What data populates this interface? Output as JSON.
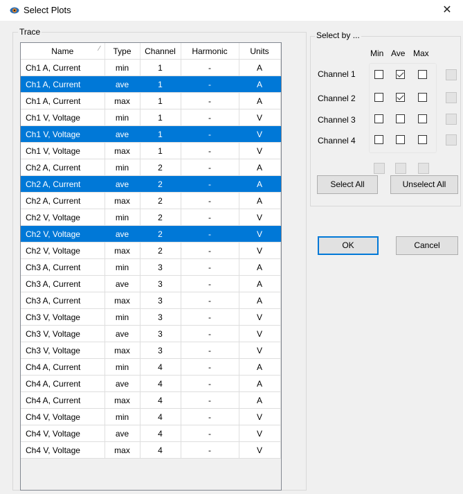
{
  "window": {
    "title": "Select Plots",
    "close": "✕"
  },
  "trace": {
    "legend": "Trace",
    "columns": [
      "Name",
      "Type",
      "Channel",
      "Harmonic",
      "Units"
    ],
    "sort_glyph": "⁄",
    "rows": [
      {
        "name": "Ch1 A, Current",
        "type": "min",
        "channel": "1",
        "harmonic": "-",
        "units": "A",
        "selected": false
      },
      {
        "name": "Ch1 A, Current",
        "type": "ave",
        "channel": "1",
        "harmonic": "-",
        "units": "A",
        "selected": true
      },
      {
        "name": "Ch1 A, Current",
        "type": "max",
        "channel": "1",
        "harmonic": "-",
        "units": "A",
        "selected": false
      },
      {
        "name": "Ch1 V, Voltage",
        "type": "min",
        "channel": "1",
        "harmonic": "-",
        "units": "V",
        "selected": false
      },
      {
        "name": "Ch1 V, Voltage",
        "type": "ave",
        "channel": "1",
        "harmonic": "-",
        "units": "V",
        "selected": true
      },
      {
        "name": "Ch1 V, Voltage",
        "type": "max",
        "channel": "1",
        "harmonic": "-",
        "units": "V",
        "selected": false
      },
      {
        "name": "Ch2 A, Current",
        "type": "min",
        "channel": "2",
        "harmonic": "-",
        "units": "A",
        "selected": false
      },
      {
        "name": "Ch2 A, Current",
        "type": "ave",
        "channel": "2",
        "harmonic": "-",
        "units": "A",
        "selected": true
      },
      {
        "name": "Ch2 A, Current",
        "type": "max",
        "channel": "2",
        "harmonic": "-",
        "units": "A",
        "selected": false
      },
      {
        "name": "Ch2 V, Voltage",
        "type": "min",
        "channel": "2",
        "harmonic": "-",
        "units": "V",
        "selected": false
      },
      {
        "name": "Ch2 V, Voltage",
        "type": "ave",
        "channel": "2",
        "harmonic": "-",
        "units": "V",
        "selected": true
      },
      {
        "name": "Ch2 V, Voltage",
        "type": "max",
        "channel": "2",
        "harmonic": "-",
        "units": "V",
        "selected": false
      },
      {
        "name": "Ch3 A, Current",
        "type": "min",
        "channel": "3",
        "harmonic": "-",
        "units": "A",
        "selected": false
      },
      {
        "name": "Ch3 A, Current",
        "type": "ave",
        "channel": "3",
        "harmonic": "-",
        "units": "A",
        "selected": false
      },
      {
        "name": "Ch3 A, Current",
        "type": "max",
        "channel": "3",
        "harmonic": "-",
        "units": "A",
        "selected": false
      },
      {
        "name": "Ch3 V, Voltage",
        "type": "min",
        "channel": "3",
        "harmonic": "-",
        "units": "V",
        "selected": false
      },
      {
        "name": "Ch3 V, Voltage",
        "type": "ave",
        "channel": "3",
        "harmonic": "-",
        "units": "V",
        "selected": false
      },
      {
        "name": "Ch3 V, Voltage",
        "type": "max",
        "channel": "3",
        "harmonic": "-",
        "units": "V",
        "selected": false
      },
      {
        "name": "Ch4 A, Current",
        "type": "min",
        "channel": "4",
        "harmonic": "-",
        "units": "A",
        "selected": false
      },
      {
        "name": "Ch4 A, Current",
        "type": "ave",
        "channel": "4",
        "harmonic": "-",
        "units": "A",
        "selected": false
      },
      {
        "name": "Ch4 A, Current",
        "type": "max",
        "channel": "4",
        "harmonic": "-",
        "units": "A",
        "selected": false
      },
      {
        "name": "Ch4 V, Voltage",
        "type": "min",
        "channel": "4",
        "harmonic": "-",
        "units": "V",
        "selected": false
      },
      {
        "name": "Ch4 V, Voltage",
        "type": "ave",
        "channel": "4",
        "harmonic": "-",
        "units": "V",
        "selected": false
      },
      {
        "name": "Ch4 V, Voltage",
        "type": "max",
        "channel": "4",
        "harmonic": "-",
        "units": "V",
        "selected": false
      }
    ]
  },
  "select_by": {
    "legend": "Select by ...",
    "column_headers": [
      "Min",
      "Ave",
      "Max"
    ],
    "channels": [
      {
        "label": "Channel 1",
        "min": false,
        "ave": true,
        "max": false
      },
      {
        "label": "Channel 2",
        "min": false,
        "ave": true,
        "max": false
      },
      {
        "label": "Channel 3",
        "min": false,
        "ave": false,
        "max": false
      },
      {
        "label": "Channel 4",
        "min": false,
        "ave": false,
        "max": false
      }
    ],
    "select_all": "Select All",
    "unselect_all": "Unselect All"
  },
  "buttons": {
    "ok": "OK",
    "cancel": "Cancel"
  },
  "colors": {
    "selection": "#0078d7",
    "focus_border": "#0078d7"
  }
}
